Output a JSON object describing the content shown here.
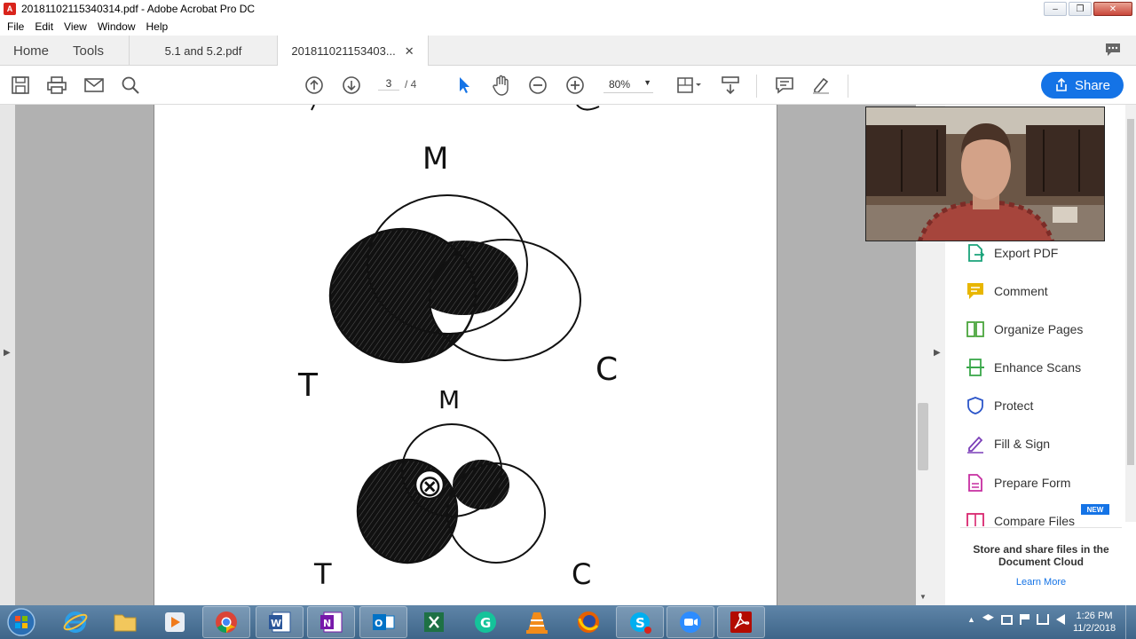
{
  "window": {
    "title": "20181102115340314.pdf - Adobe Acrobat Pro DC"
  },
  "menu": [
    "File",
    "Edit",
    "View",
    "Window",
    "Help"
  ],
  "tabs": {
    "home": "Home",
    "tools": "Tools",
    "documents": [
      {
        "label": "5.1 and 5.2.pdf",
        "active": false
      },
      {
        "label": "201811021153403...",
        "active": true
      }
    ]
  },
  "toolbar": {
    "current_page": "3",
    "total_pages": "/ 4",
    "zoom": "80%",
    "share_label": "Share"
  },
  "document": {
    "diagram1_labels": {
      "top": "M",
      "left": "T",
      "right": "C"
    },
    "diagram2_labels": {
      "top": "M",
      "left": "T",
      "right": "C"
    },
    "diagram2_mark": "⊗"
  },
  "right_panel": {
    "tools": [
      {
        "label": "Export PDF",
        "icon": "export-pdf-icon",
        "color": "#1aa37a"
      },
      {
        "label": "Comment",
        "icon": "comment-icon",
        "color": "#e8b600"
      },
      {
        "label": "Organize Pages",
        "icon": "organize-pages-icon",
        "color": "#4aa53c"
      },
      {
        "label": "Enhance Scans",
        "icon": "enhance-scans-icon",
        "color": "#3aa84a"
      },
      {
        "label": "Protect",
        "icon": "protect-icon",
        "color": "#2b55c9"
      },
      {
        "label": "Fill & Sign",
        "icon": "fill-sign-icon",
        "color": "#7b3fb8"
      },
      {
        "label": "Prepare Form",
        "icon": "prepare-form-icon",
        "color": "#c62ea1"
      },
      {
        "label": "Compare Files",
        "icon": "compare-files-icon",
        "color": "#d9266f"
      }
    ],
    "new_badge": "NEW",
    "cloud_text": "Store and share files in the Document Cloud",
    "learn_more": "Learn More"
  },
  "taskbar": {
    "time": "1:26 PM",
    "date": "11/2/2018"
  },
  "colors": {
    "accent": "#1473e6"
  }
}
